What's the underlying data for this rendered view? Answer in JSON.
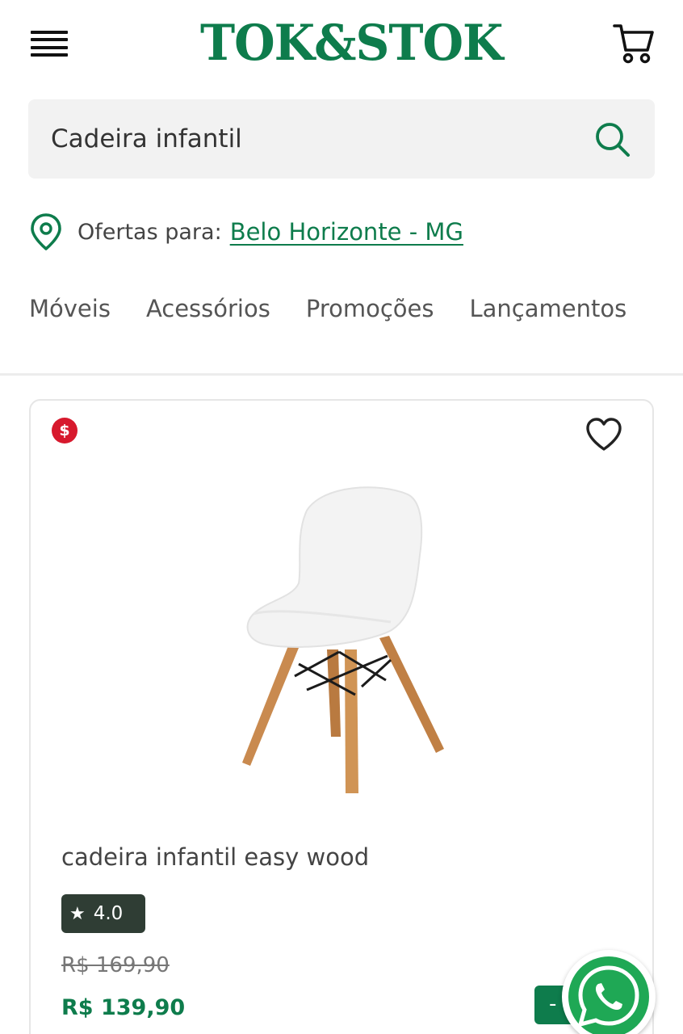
{
  "header": {
    "menu_icon": "hamburger-menu-icon",
    "logo_text": "TOK&STOK",
    "cart_icon": "shopping-cart-icon"
  },
  "search": {
    "value": "Cadeira infantil",
    "icon": "search-icon"
  },
  "location": {
    "icon": "map-pin-icon",
    "label": "Ofertas para:",
    "city": "Belo Horizonte - MG"
  },
  "categories": [
    {
      "label": "Móveis"
    },
    {
      "label": "Acessórios"
    },
    {
      "label": "Promoções"
    },
    {
      "label": "Lançamentos"
    }
  ],
  "product": {
    "badge": "$",
    "name": "cadeira infantil easy wood",
    "rating": "4.0",
    "old_price": "R$ 169,90",
    "price": "R$ 139,90",
    "add_label": "-",
    "favorite_icon": "heart-icon",
    "image": "white-child-chair-wooden-legs"
  },
  "floating": {
    "whatsapp_icon": "whatsapp-icon"
  },
  "colors": {
    "brand": "#0e7c4c",
    "sale": "#d7192d",
    "rating_bg": "#2f3d34",
    "whatsapp": "#1fa855"
  }
}
